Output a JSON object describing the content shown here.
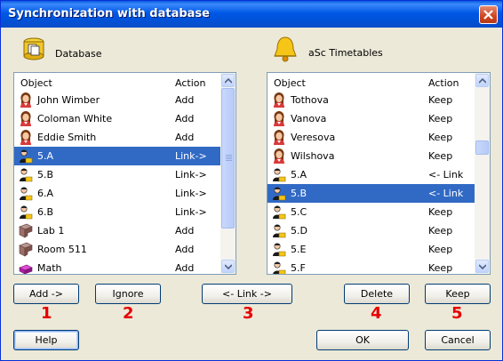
{
  "window": {
    "title": "Synchronization with database"
  },
  "left_panel": {
    "label": "Database",
    "columns": {
      "object": "Object",
      "action": "Action"
    },
    "rows": [
      {
        "icon": "person-female-icon",
        "name": "John Wimber",
        "action": "Add",
        "selected": false
      },
      {
        "icon": "person-female-icon",
        "name": "Coloman White",
        "action": "Add",
        "selected": false
      },
      {
        "icon": "person-female-icon",
        "name": "Eddie Smith",
        "action": "Add",
        "selected": false
      },
      {
        "icon": "class-students-icon",
        "name": "5.A",
        "action": "Link->",
        "selected": true
      },
      {
        "icon": "class-students-icon",
        "name": "5.B",
        "action": "Link->",
        "selected": false
      },
      {
        "icon": "class-students-icon",
        "name": "6.A",
        "action": "Link->",
        "selected": false
      },
      {
        "icon": "class-students-icon",
        "name": "6.B",
        "action": "Link->",
        "selected": false
      },
      {
        "icon": "classroom-icon",
        "name": "Lab 1",
        "action": "Add",
        "selected": false
      },
      {
        "icon": "classroom-icon",
        "name": "Room 511",
        "action": "Add",
        "selected": false
      },
      {
        "icon": "subject-book-icon",
        "name": "Math",
        "action": "Add",
        "selected": false
      }
    ]
  },
  "right_panel": {
    "label": "aSc Timetables",
    "columns": {
      "object": "Object",
      "action": "Action"
    },
    "rows": [
      {
        "icon": "person-female-icon",
        "name": "Tothova",
        "action": "Keep",
        "selected": false
      },
      {
        "icon": "person-female-icon",
        "name": "Vanova",
        "action": "Keep",
        "selected": false
      },
      {
        "icon": "person-female-icon",
        "name": "Veresova",
        "action": "Keep",
        "selected": false
      },
      {
        "icon": "person-female-icon",
        "name": "Wilshova",
        "action": "Keep",
        "selected": false
      },
      {
        "icon": "class-students-icon",
        "name": "5.A",
        "action": "<- Link",
        "selected": false
      },
      {
        "icon": "class-students-icon",
        "name": "5.B",
        "action": "<- Link",
        "selected": true
      },
      {
        "icon": "class-students-icon",
        "name": "5.C",
        "action": "Keep",
        "selected": false
      },
      {
        "icon": "class-students-icon",
        "name": "5.D",
        "action": "Keep",
        "selected": false
      },
      {
        "icon": "class-students-icon",
        "name": "5.E",
        "action": "Keep",
        "selected": false
      },
      {
        "icon": "class-students-icon",
        "name": "5.F",
        "action": "Keep",
        "selected": false
      }
    ]
  },
  "buttons": {
    "add": "Add ->",
    "ignore": "Ignore",
    "link": "<- Link ->",
    "delete": "Delete",
    "keep": "Keep",
    "help": "Help",
    "ok": "OK",
    "cancel": "Cancel"
  },
  "annotations": [
    "1",
    "2",
    "3",
    "4",
    "5"
  ],
  "colors": {
    "selection": "#316ac5",
    "annotation": "#e60000",
    "title_bar": "#0058e6"
  }
}
